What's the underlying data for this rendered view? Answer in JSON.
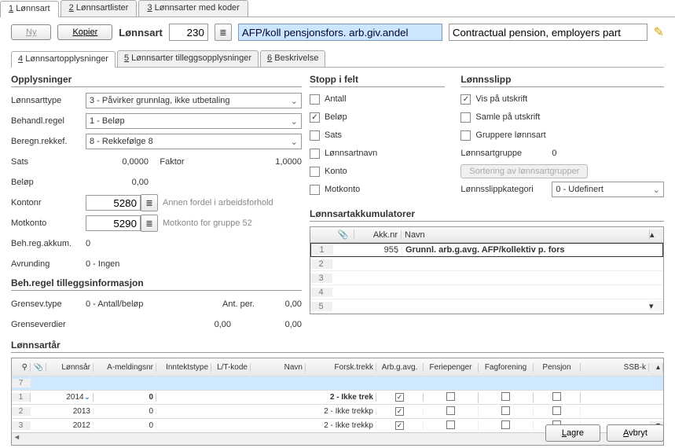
{
  "topTabs": {
    "t1": "Lønnsart",
    "t2": "Lønnsartlister",
    "t3": "Lønnsarter med koder"
  },
  "toolbar": {
    "ny": "Ny",
    "kopier": "Kopier",
    "lonnsart_label": "Lønnsart",
    "code": "230",
    "main_value": "AFP/koll pensjonsfors. arb.giv.andel",
    "desc_value": "Contractual pension, employers part"
  },
  "subTabs": {
    "t4": "Lønnsartopplysninger",
    "t5": "Lønnsarter tilleggsopplysninger",
    "t6": "Beskrivelse"
  },
  "opplys": {
    "title": "Opplysninger",
    "type_l": "Lønnsarttype",
    "type_v": "3 - Påvirker grunnlag, ikke utbetaling",
    "beh_l": "Behandl.regel",
    "beh_v": "1 - Beløp",
    "ber_l": "Beregn.rekkef.",
    "ber_v": "8 - Rekkefølge 8",
    "sats_l": "Sats",
    "sats_v": "0,0000",
    "faktor_l": "Faktor",
    "faktor_v": "1,0000",
    "belop_l": "Beløp",
    "belop_v": "0,00",
    "konto_l": "Kontonr",
    "konto_v": "5280",
    "konto_desc": "Annen fordel i arbeidsforhold",
    "motk_l": "Motkonto",
    "motk_v": "5290",
    "motk_desc": "Motkonto for gruppe 52",
    "bra_l": "Beh.reg.akkum.",
    "bra_v": "0",
    "avr_l": "Avrunding",
    "avr_v": "0 - Ingen"
  },
  "brt": {
    "title": "Beh.regel tilleggsinformasjon",
    "gt_l": "Grensev.type",
    "gt_v": "0 - Antall/beløp",
    "ap_l": "Ant. per.",
    "ap_v": "0,00",
    "gv_l": "Grenseverdier",
    "gv_v1": "0,00",
    "gv_v2": "0,00"
  },
  "stopp": {
    "title": "Stopp i felt",
    "antall": "Antall",
    "belop": "Beløp",
    "sats": "Sats",
    "lnavn": "Lønnsartnavn",
    "konto": "Konto",
    "motkonto": "Motkonto"
  },
  "slip": {
    "title": "Lønnsslipp",
    "vis": "Vis på utskrift",
    "samle": "Samle på utskrift",
    "grup": "Gruppere lønnsart",
    "lag_l": "Lønnsartgruppe",
    "lag_v": "0",
    "sort_btn": "Sortering av lønnsartgrupper",
    "kat_l": "Lønnsslippkategori",
    "kat_v": "0 - Udefinert"
  },
  "akk": {
    "title": "Lønnsartakkumulatorer",
    "h_akknr": "Akk.nr",
    "h_navn": "Navn",
    "r1_nr": "955",
    "r1_navn": "Grunnl. arb.g.avg. AFP/kollektiv p. fors"
  },
  "yt": {
    "title": "Lønnsartår",
    "h_aar": "Lønnsår",
    "h_ameld": "A-meldingsnr",
    "h_intype": "Inntektstype",
    "h_lt": "L/T-kode",
    "h_navn": "Navn",
    "h_ft": "Forsk.trekk",
    "h_arbg": "Arb.g.avg.",
    "h_ferie": "Feriepenger",
    "h_fag": "Fagforening",
    "h_pensj": "Pensjon",
    "h_ssb": "SSB-k",
    "rows": [
      {
        "idx": "7"
      },
      {
        "idx": "1",
        "aar": "2014",
        "ameld": "0",
        "ft": "2 - Ikke trek",
        "arbg": true
      },
      {
        "idx": "2",
        "aar": "2013",
        "ameld": "0",
        "ft": "2 - Ikke trekkp",
        "arbg": true
      },
      {
        "idx": "3",
        "aar": "2012",
        "ameld": "0",
        "ft": "2 - Ikke trekkp",
        "arbg": true
      }
    ]
  },
  "footer": {
    "lagre": "Lagre",
    "avbryt": "Avbryt"
  }
}
